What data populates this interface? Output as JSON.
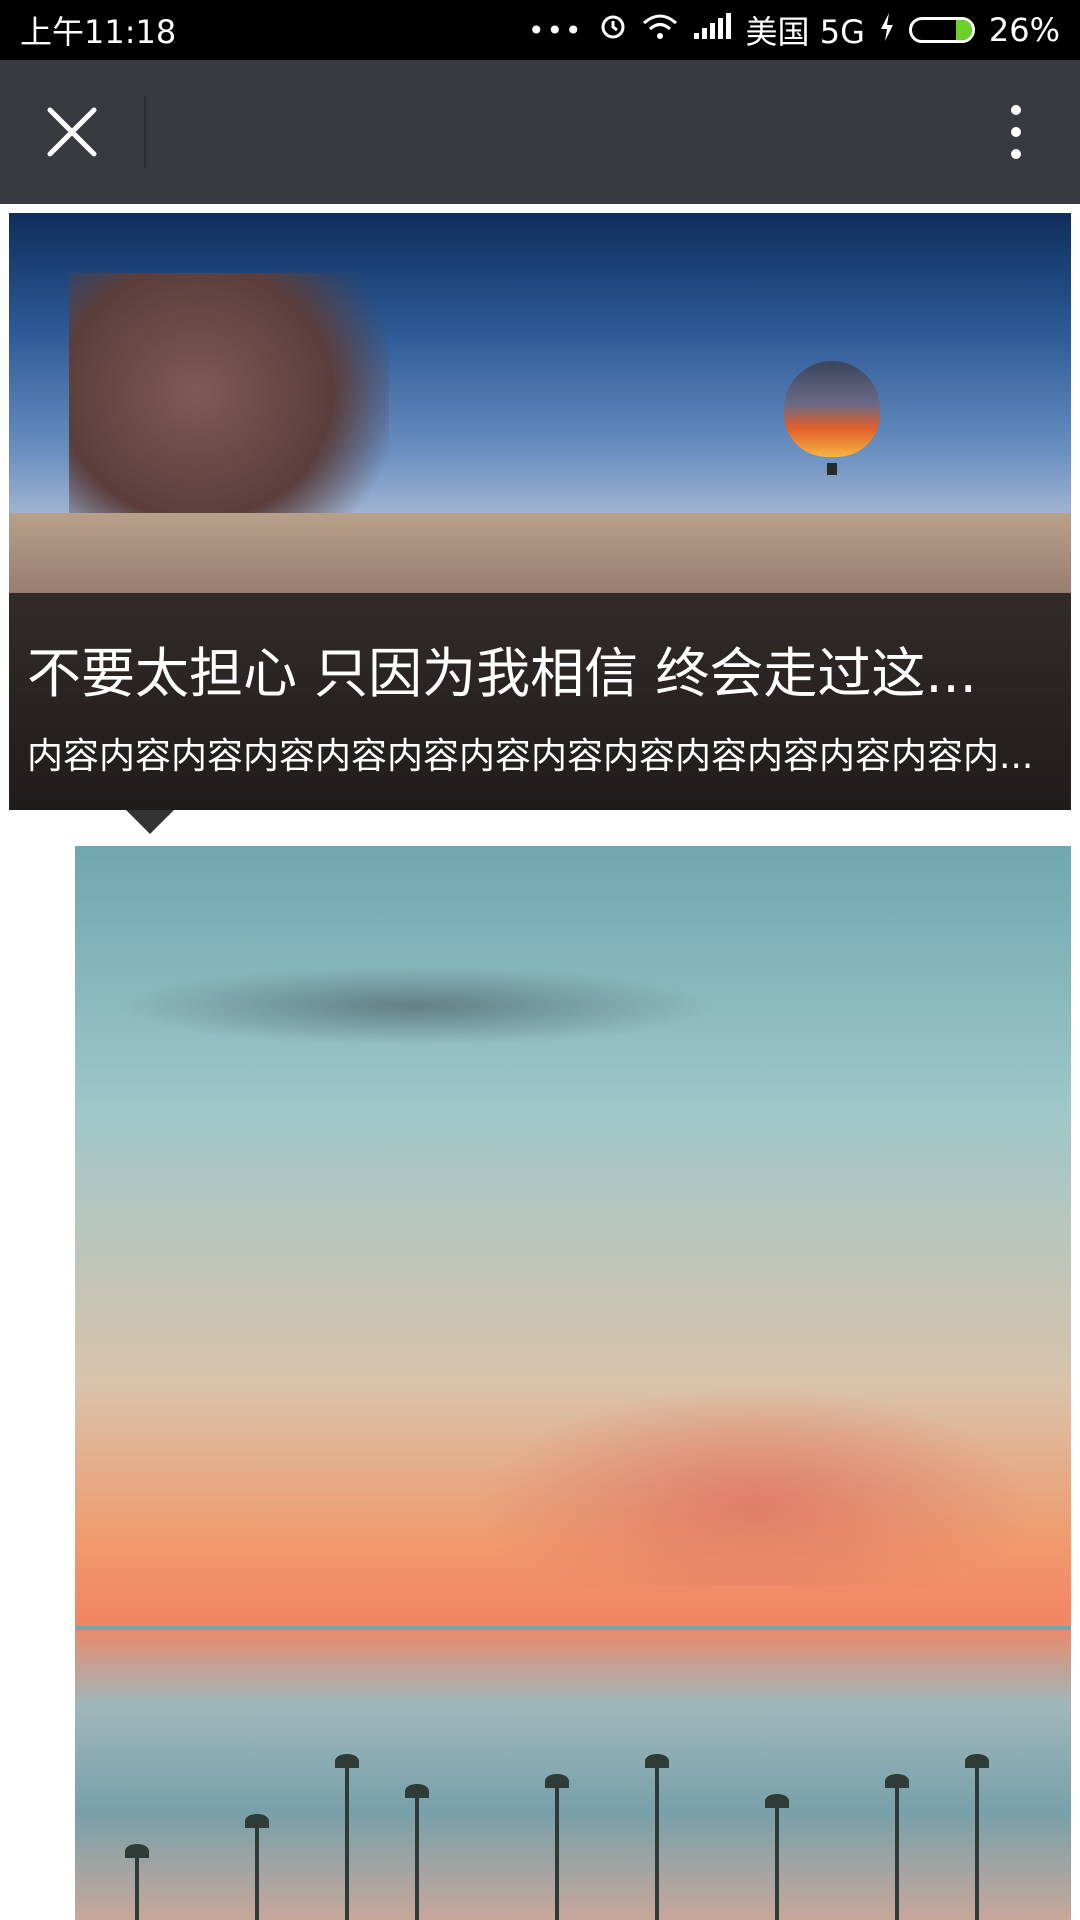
{
  "status_bar": {
    "time": "上午11:18",
    "more": "•••",
    "carrier": "美国 5G",
    "battery": "26%",
    "battery_level": 0.26,
    "icons": [
      "alarm-icon",
      "wifi-icon",
      "signal-icon",
      "charging-icon",
      "battery-icon"
    ]
  },
  "toolbar": {
    "close_icon": "close-icon",
    "more_icon": "more-vertical-icon"
  },
  "hero": {
    "title": "不要太担心 只因为我相信 终会走过这...",
    "description": "内容内容内容内容内容内容内容内容内容内容内容内容内容内..."
  },
  "colors": {
    "status_bar_bg": "#000000",
    "toolbar_bg": "#393a3f",
    "caption_bg": "rgba(20,20,22,0.78)"
  }
}
